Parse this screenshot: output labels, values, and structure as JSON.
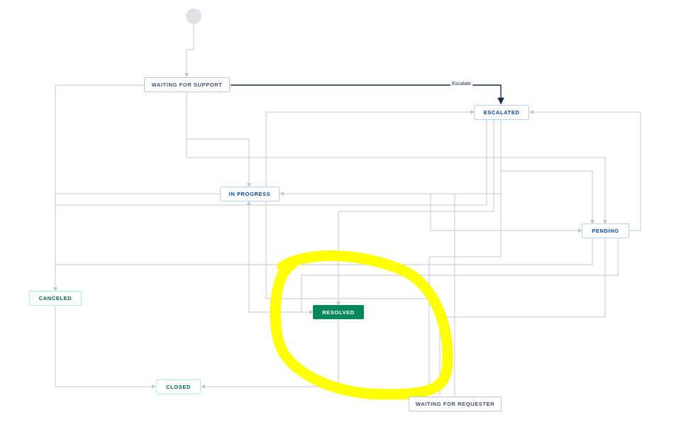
{
  "statuses": {
    "waiting_for_support": "WAITING FOR SUPPORT",
    "escalated": "ESCALATED",
    "in_progress": "IN PROGRESS",
    "pending": "PENDING",
    "canceled": "CANCELED",
    "resolved": "RESOLVED",
    "closed": "CLOSED",
    "waiting_for_requester": "WAITING FOR REQUESTER"
  },
  "transitions": {
    "escalate": "Escalate"
  },
  "colors": {
    "line": "#c1c7d0",
    "line_selected": "#172b4d",
    "highlight": "#ffff00",
    "resolved_fill": "#00875a",
    "start_circle": "#dfe1e6"
  }
}
